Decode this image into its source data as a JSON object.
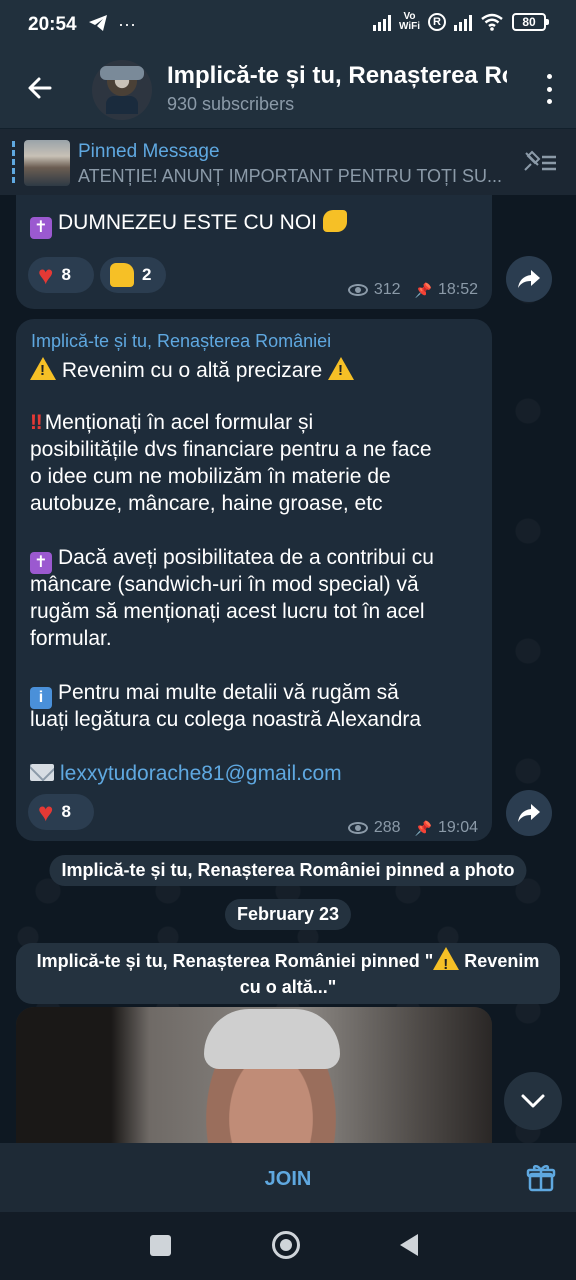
{
  "status_bar": {
    "time": "20:54",
    "vowifi_top": "Vo",
    "vowifi_bottom": "WiFi",
    "r_label": "R",
    "battery": "80"
  },
  "header": {
    "title": "Implică-te și tu, Renașterea Ro",
    "subtitle": "930 subscribers"
  },
  "pinned": {
    "title": "Pinned Message",
    "text": "ATENȚIE! ANUNȚ IMPORTANT PENTRU TOȚI SU..."
  },
  "messages": [
    {
      "text": "DUMNEZEU ESTE CU NOI",
      "reactions": [
        {
          "emoji": "heart",
          "count": "8"
        },
        {
          "emoji": "thumbs-up",
          "count": "2"
        }
      ],
      "views": "312",
      "time": "18:52"
    },
    {
      "sender": "Implică-te și tu, Renașterea României",
      "line1": "Revenim cu o altă precizare",
      "para2": [
        "Menționați în acel formular și",
        "posibilitățile dvs financiare pentru a ne face",
        "o idee cum ne mobilizăm în materie de",
        "autobuze, mâncare, haine groase, etc"
      ],
      "para3": [
        "Dacă aveți posibilitatea de a contribui cu",
        "mâncare (sandwich-uri în mod special) vă",
        "rugăm să menționați acest lucru tot în acel",
        "formular."
      ],
      "para4": [
        "Pentru mai multe detalii vă rugăm să",
        "luați legătura cu colega noastră Alexandra"
      ],
      "email": "lexxytudorache81@gmail.com",
      "reactions": [
        {
          "emoji": "heart",
          "count": "8"
        }
      ],
      "views": "288",
      "time": "19:04"
    }
  ],
  "service": {
    "pinned_photo": "Implică-te și tu, Renașterea României pinned a photo",
    "date": "February 23",
    "pinned_quote_a": "Implică-te și tu, Renașterea României pinned \"",
    "pinned_quote_b": " Revenim cu o altă...\""
  },
  "join_bar": {
    "join_label": "JOIN"
  },
  "colors": {
    "accent": "#5fa8e0",
    "bubble": "#1e2c3a",
    "background": "#0f1a24"
  }
}
